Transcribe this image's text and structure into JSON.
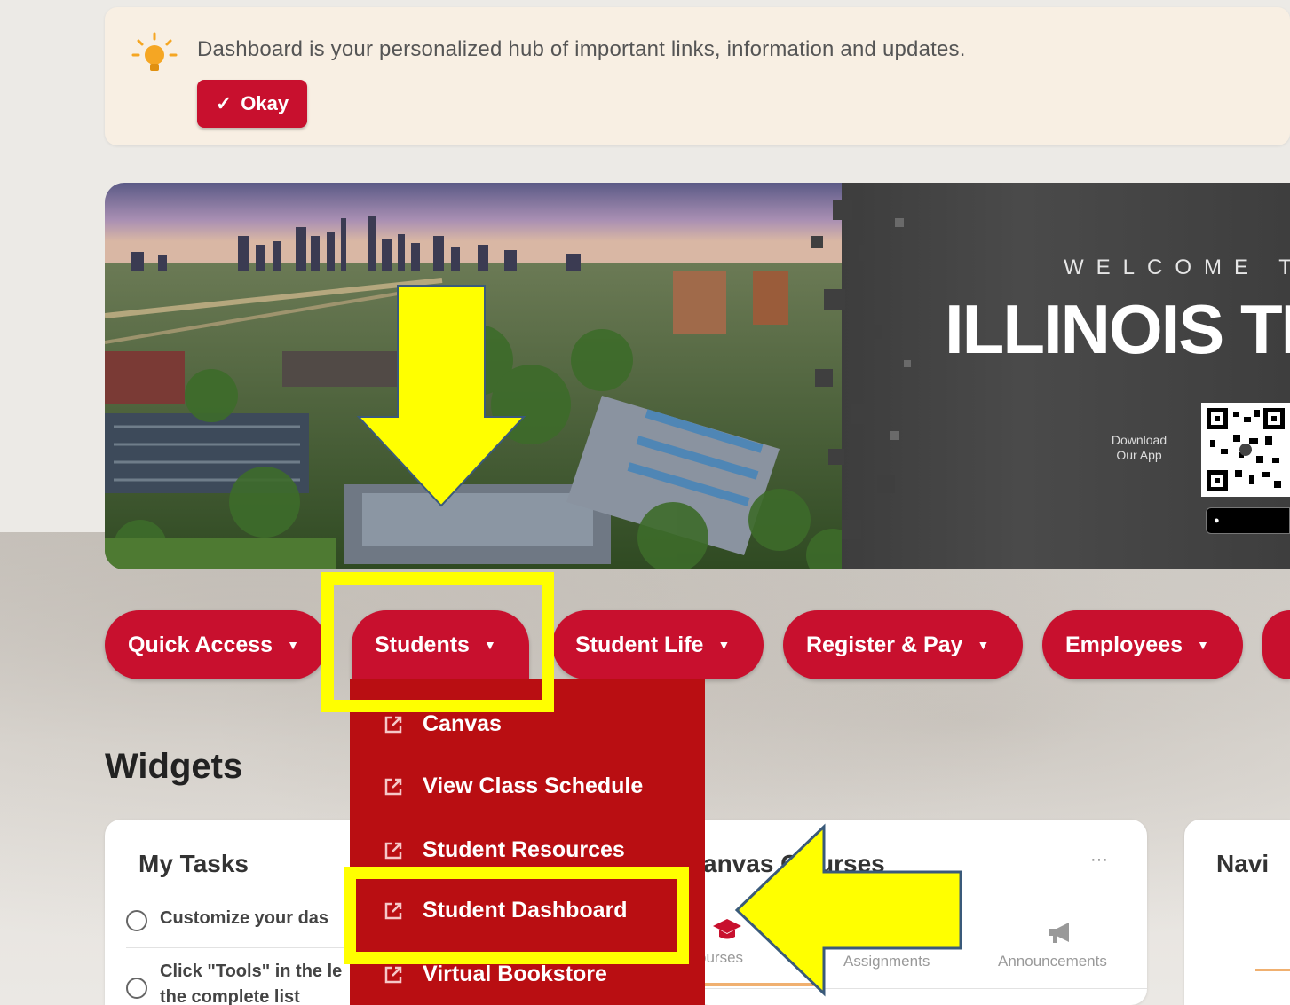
{
  "notice": {
    "text": "Dashboard is your personalized hub of important links, information and updates.",
    "okay_label": "Okay"
  },
  "banner": {
    "welcome": "WELCOME T",
    "brand": "ILLINOIS TE",
    "download_line1": "Download",
    "download_line2": "Our App"
  },
  "nav": {
    "items": [
      {
        "label": "Quick Access"
      },
      {
        "label": "Students"
      },
      {
        "label": "Student Life"
      },
      {
        "label": "Register & Pay"
      },
      {
        "label": "Employees"
      }
    ]
  },
  "dropdown": {
    "items": [
      {
        "label": "Canvas"
      },
      {
        "label": "View Class Schedule"
      },
      {
        "label": "Student Resources"
      },
      {
        "label": "Student Dashboard"
      },
      {
        "label": "Virtual Bookstore"
      }
    ]
  },
  "widgets": {
    "title": "Widgets",
    "my_tasks": {
      "title": "My Tasks",
      "tasks": [
        {
          "label": "Customize your das"
        },
        {
          "label": "Click \"Tools\" in the le",
          "label2": "the complete list"
        }
      ]
    },
    "canvas": {
      "title": "anvas C",
      "title_end": "urses",
      "menu": "···",
      "tabs": [
        "ourses",
        "Assignments",
        "Announcements"
      ]
    },
    "navigate": {
      "title": "Navi"
    }
  },
  "colors": {
    "brand_red": "#c8102e",
    "dropdown_red": "#b90e12",
    "highlight_yellow": "#ffff00"
  }
}
